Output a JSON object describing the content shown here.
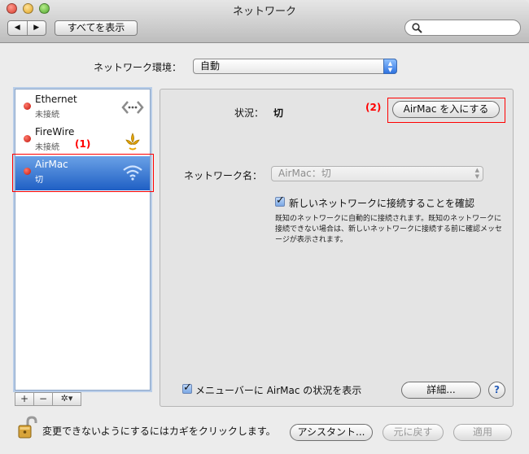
{
  "window": {
    "title": "ネットワーク"
  },
  "toolbar": {
    "back_glyph": "◀",
    "forward_glyph": "▶",
    "show_all_label": "すべてを表示",
    "search_placeholder": ""
  },
  "location": {
    "label": "ネットワーク環境：",
    "value": "自動"
  },
  "services": [
    {
      "name": "Ethernet",
      "status": "未接続",
      "icon": "ethernet-icon"
    },
    {
      "name": "FireWire",
      "status": "未接続",
      "icon": "firewire-icon"
    },
    {
      "name": "AirMac",
      "status": "切",
      "icon": "wifi-icon",
      "selected": true
    }
  ],
  "annotations": {
    "one": "(1)",
    "two": "(2)"
  },
  "sidebar_buttons": {
    "add": "+",
    "remove": "−",
    "action": "✲▾"
  },
  "panel": {
    "status_label": "状況：",
    "status_value": "切",
    "turn_on_button": "AirMac を入にする",
    "network_name_label": "ネットワーク名：",
    "network_name_value": "AirMac：切",
    "confirm_checkbox_label": "新しいネットワークに接続することを確認",
    "confirm_description": "既知のネットワークに自動的に接続されます。既知のネットワークに接続できない場合は、新しいネットワークに接続する前に確認メッセージが表示されます。",
    "show_menu_checkbox_label": "メニューバーに AirMac の状況を表示",
    "advanced_button": "詳細...",
    "help_button": "?"
  },
  "footer": {
    "lock_text": "変更できないようにするにはカギをクリックします。",
    "assistant_button": "アシスタント...",
    "revert_button": "元に戻す",
    "apply_button": "適用"
  },
  "colors": {
    "selection": "#1f5fc4",
    "annotation": "#ff0000",
    "status_off": "#c0120a"
  }
}
